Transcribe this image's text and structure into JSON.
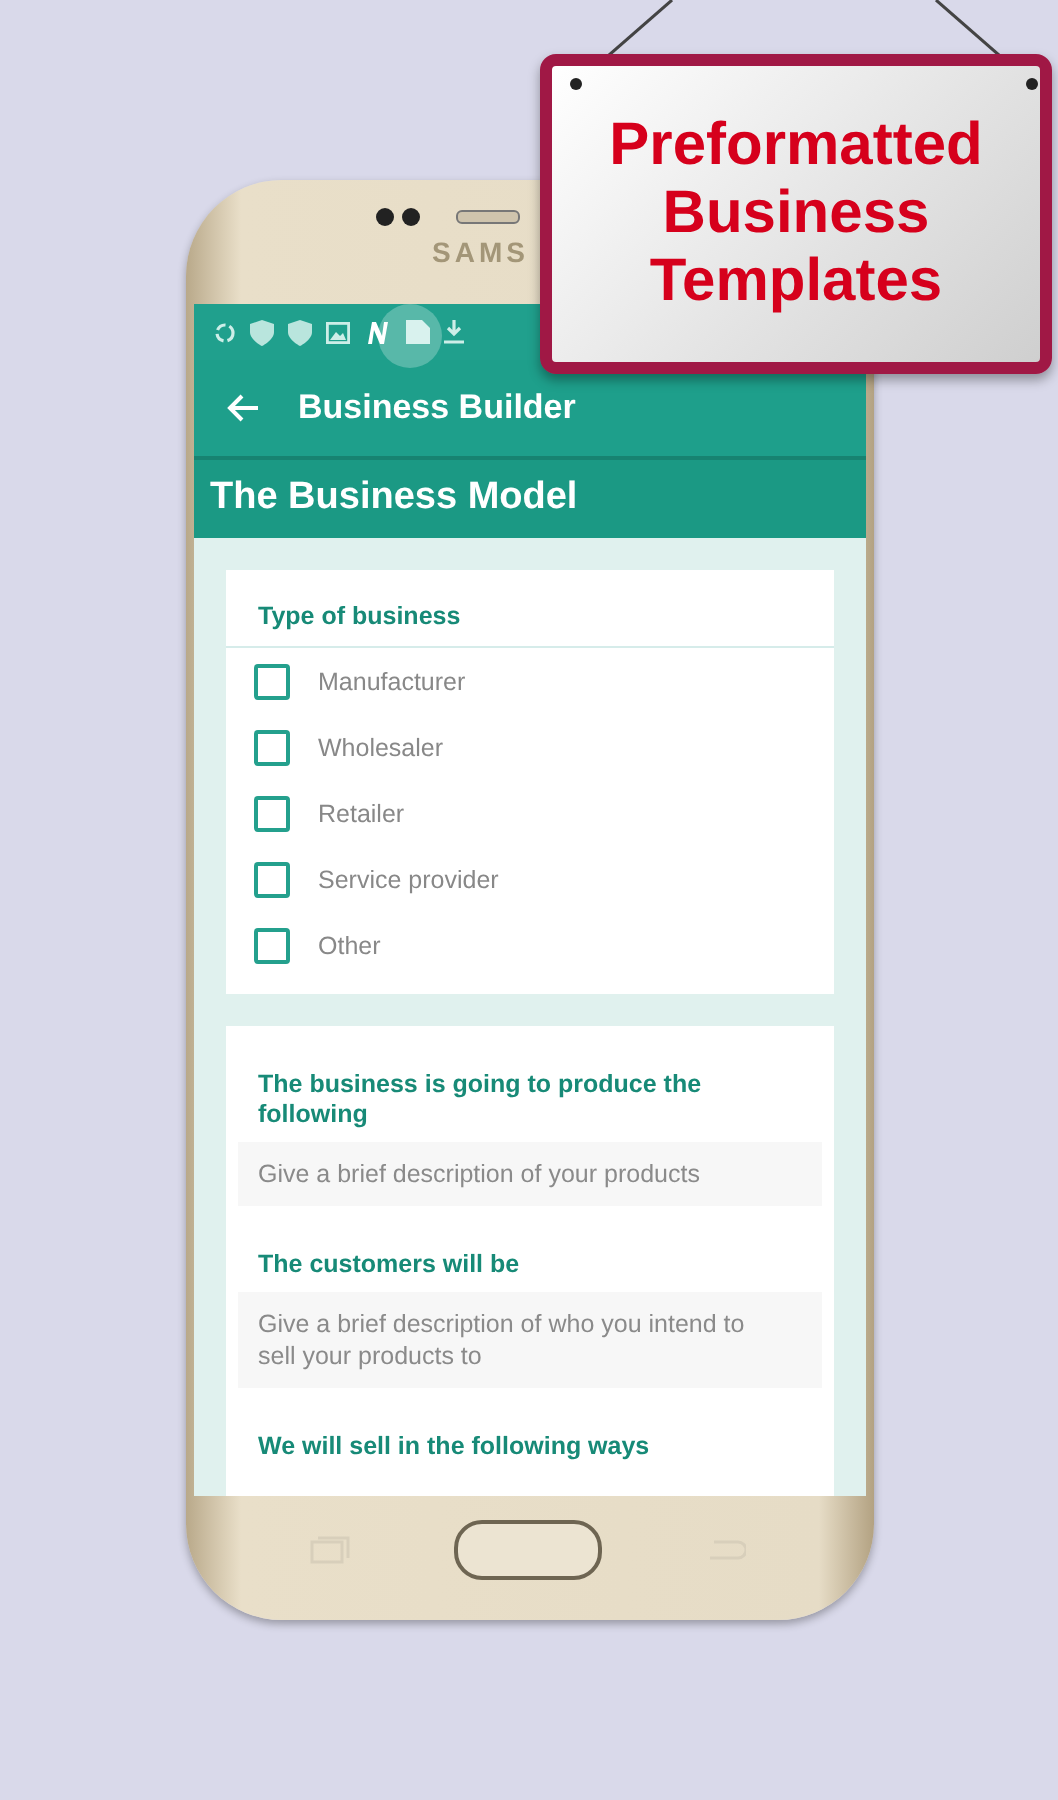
{
  "promo_sign": {
    "text": "Preformatted Business Templates"
  },
  "phone": {
    "brand": "SAMS"
  },
  "app_bar": {
    "title": "Business Builder"
  },
  "section_title": "The Business Model",
  "type_card": {
    "heading": "Type of business",
    "options": [
      {
        "label": "Manufacturer",
        "checked": false
      },
      {
        "label": "Wholesaler",
        "checked": false
      },
      {
        "label": "Retailer",
        "checked": false
      },
      {
        "label": "Service provider",
        "checked": false
      },
      {
        "label": "Other",
        "checked": false
      }
    ]
  },
  "questions": [
    {
      "label": "The business is going to produce the following",
      "placeholder": "Give a brief description of your products"
    },
    {
      "label": "The customers will be",
      "placeholder": "Give a brief description of who you intend to sell your products to"
    },
    {
      "label": "We will sell in the following ways"
    }
  ]
}
